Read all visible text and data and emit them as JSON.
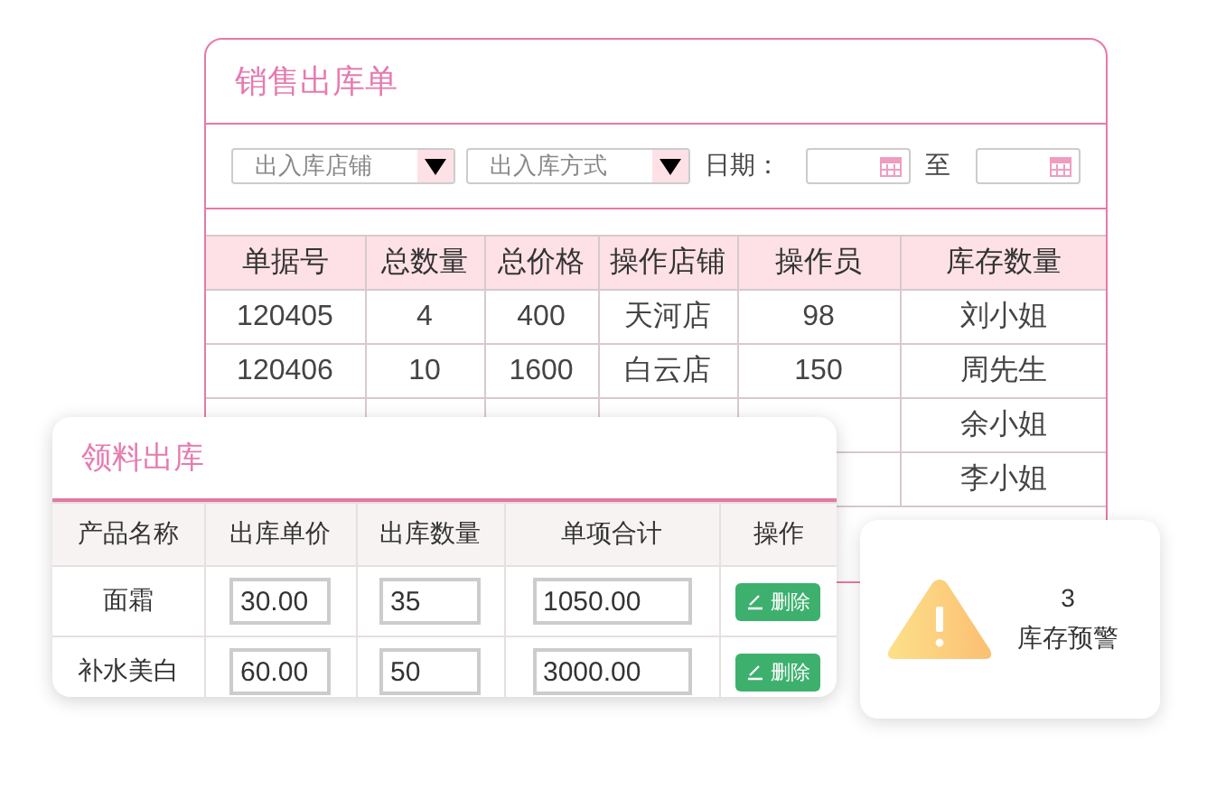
{
  "order_card": {
    "title": "销售出库单",
    "filters": [
      {
        "kind": "select",
        "label": "出入库店铺"
      },
      {
        "kind": "select",
        "label": "出入库方式"
      },
      {
        "kind": "label",
        "text": "日期："
      },
      {
        "kind": "date"
      },
      {
        "kind": "label",
        "text": "至"
      },
      {
        "kind": "date"
      }
    ],
    "table": {
      "columns": [
        "单据号",
        "总数量",
        "总价格",
        "操作店铺",
        "操作员",
        "库存数量"
      ],
      "rows": [
        {
          "cells": [
            "120405",
            "4",
            "400",
            "天河店",
            "98",
            "刘小姐"
          ]
        },
        {
          "cells": [
            "120406",
            "10",
            "1600",
            "白云店",
            "150",
            "周先生"
          ]
        },
        {
          "cells": [
            "余小姐"
          ]
        },
        {
          "cells": [
            "李小姐"
          ]
        }
      ]
    }
  },
  "issue_card": {
    "title": "领料出库",
    "columns": [
      "产品名称",
      "出库单价",
      "出库数量",
      "单项合计",
      "操作"
    ],
    "rows": [
      {
        "product": "面霜",
        "unit_price": "30.00",
        "quantity": "35",
        "subtotal": "1050.00",
        "action": "删除"
      },
      {
        "product": "补水美白",
        "unit_price": "60.00",
        "quantity": "50",
        "subtotal": "3000.00",
        "action": "删除"
      }
    ]
  },
  "alert": {
    "count": "3",
    "label": "库存预警"
  }
}
